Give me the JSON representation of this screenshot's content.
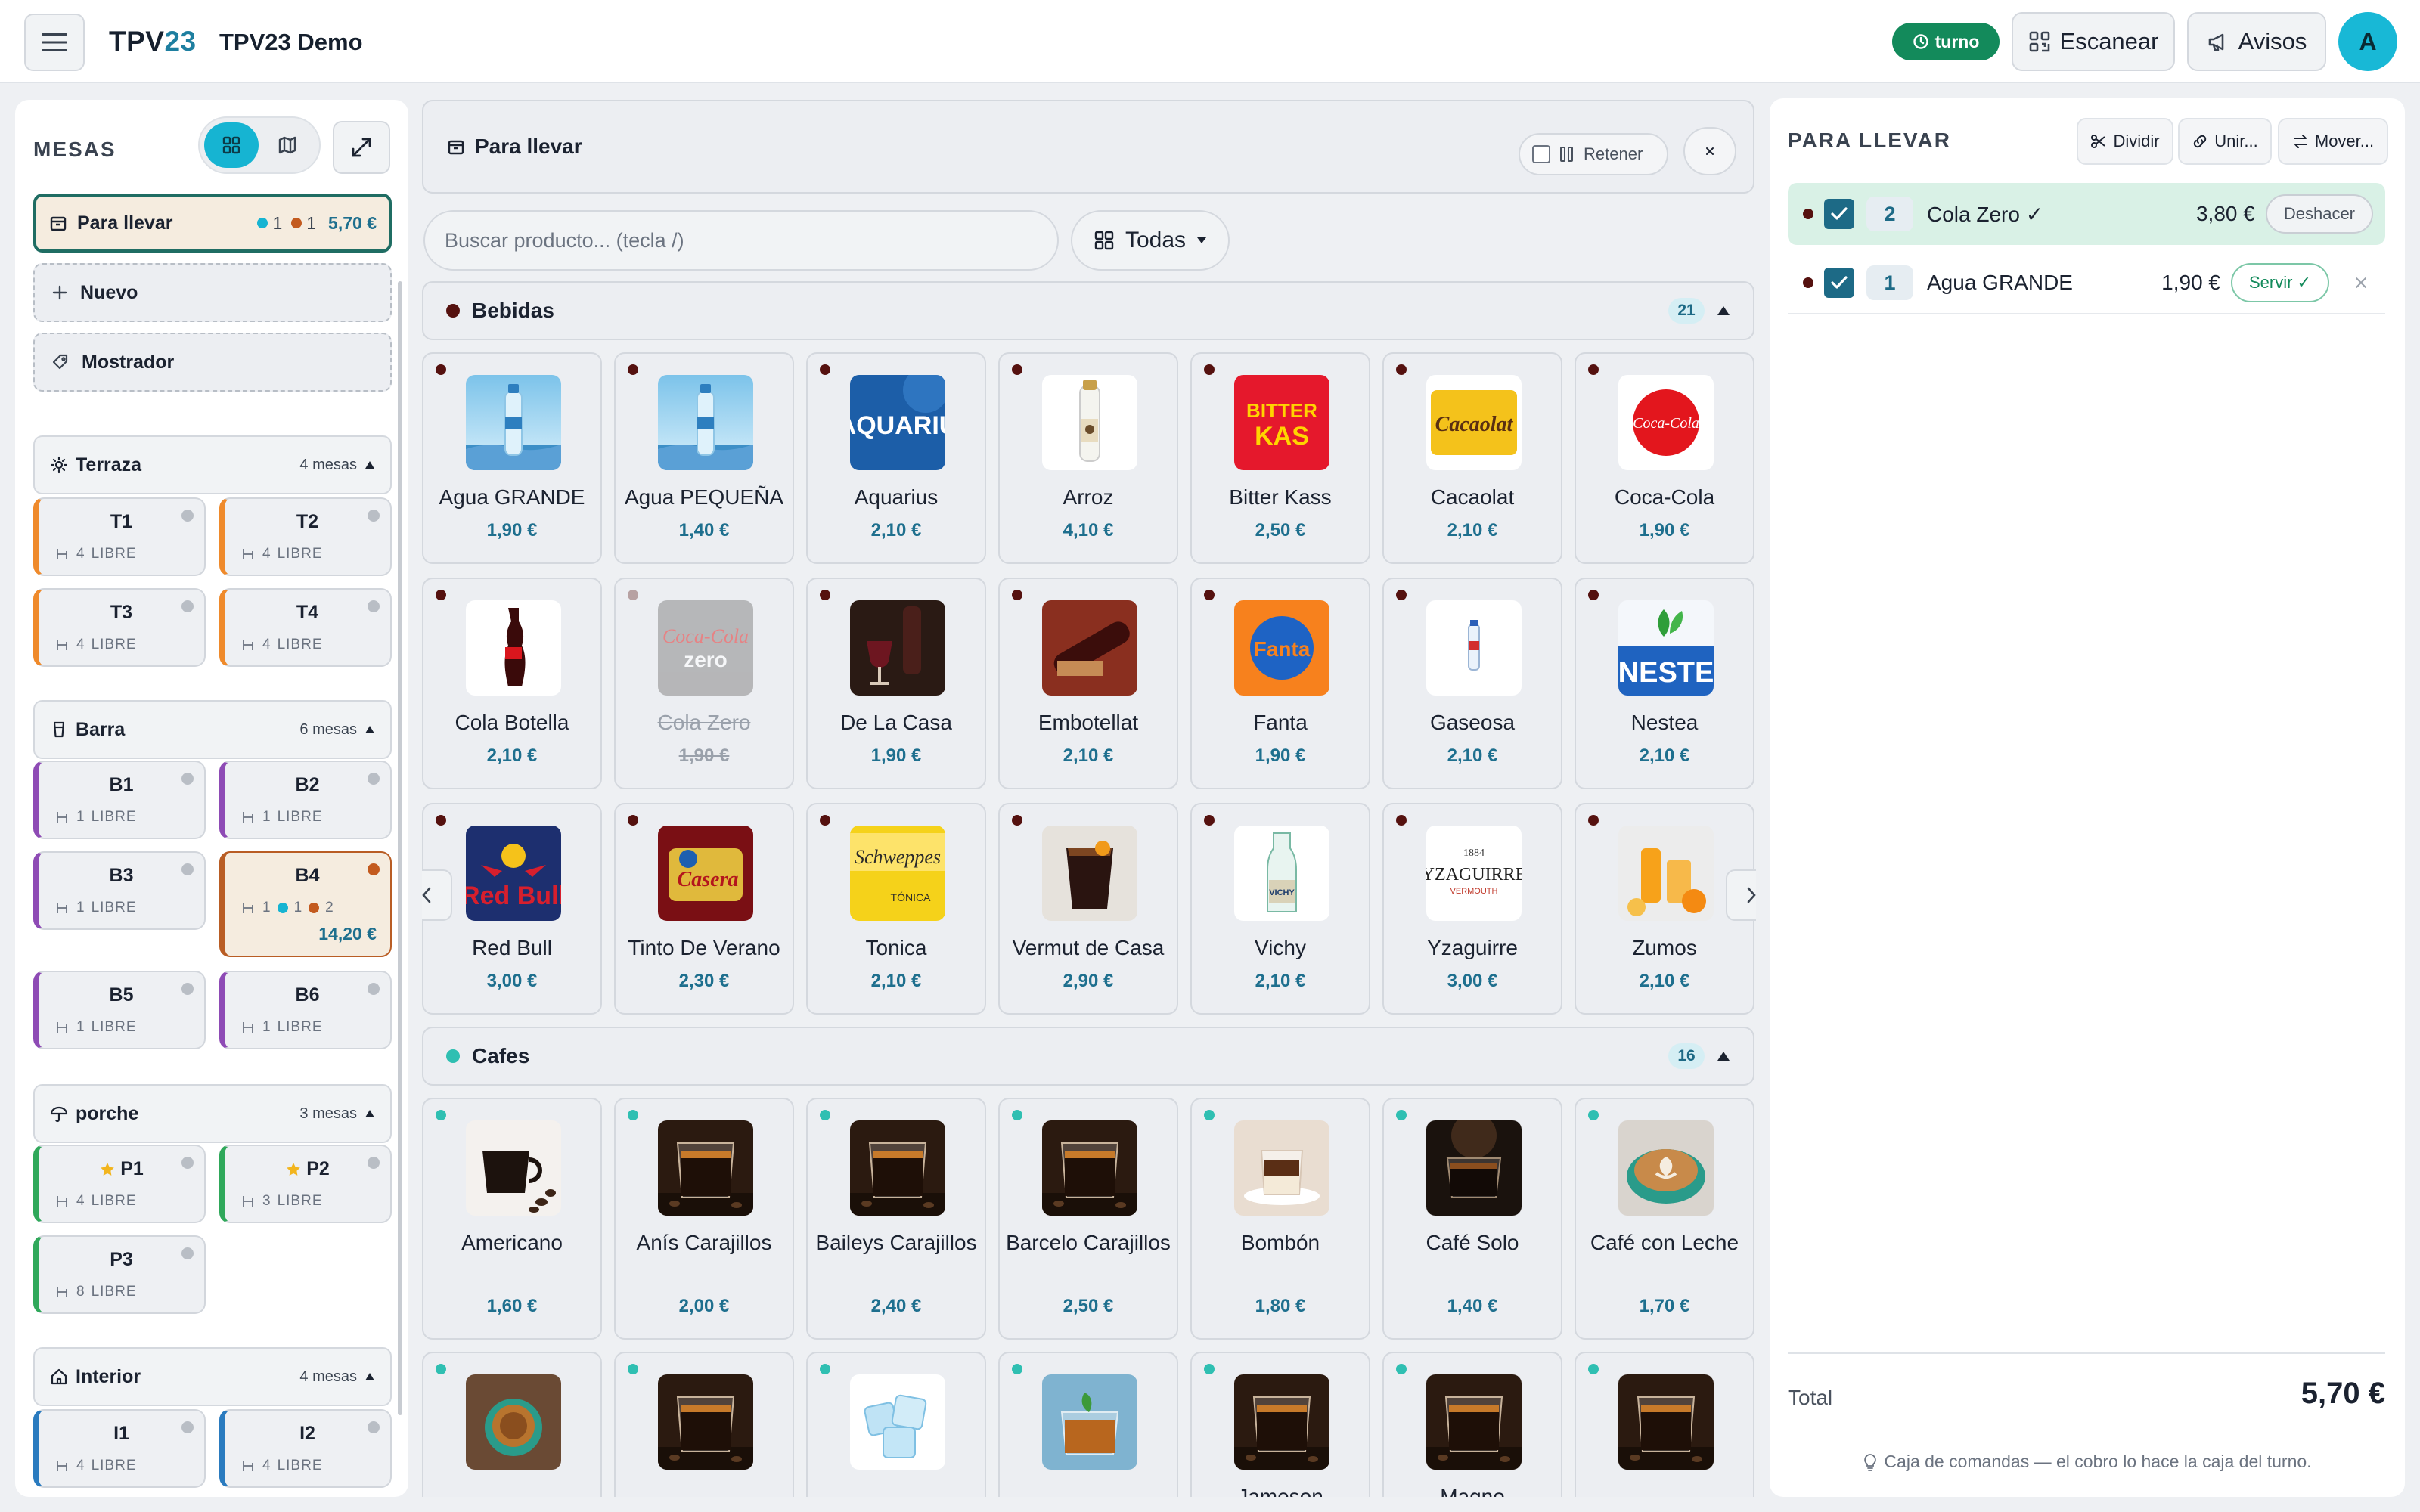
{
  "header": {
    "brand_prefix": "TPV",
    "brand_number": "23",
    "app_title": "TPV23 Demo",
    "turno_label": "turno",
    "scan_label": "Escanear",
    "avisos_label": "Avisos",
    "avatar_initial": "A"
  },
  "sidebar": {
    "title": "MESAS",
    "para_llevar": {
      "label": "Para llevar",
      "count_a": "1",
      "count_b": "1",
      "amount": "5,70 €"
    },
    "nuevo_label": "Nuevo",
    "mostrador_label": "Mostrador",
    "zones": [
      {
        "name": "Terraza",
        "count": "4 mesas",
        "tables": [
          {
            "name": "T1",
            "seats": "4",
            "status": "LIBRE"
          },
          {
            "name": "T2",
            "seats": "4",
            "status": "LIBRE"
          },
          {
            "name": "T3",
            "seats": "4",
            "status": "LIBRE"
          },
          {
            "name": "T4",
            "seats": "4",
            "status": "LIBRE"
          }
        ]
      },
      {
        "name": "Barra",
        "count": "6 mesas",
        "tables": [
          {
            "name": "B1",
            "seats": "1",
            "status": "LIBRE"
          },
          {
            "name": "B2",
            "seats": "1",
            "status": "LIBRE"
          },
          {
            "name": "B3",
            "seats": "1",
            "status": "LIBRE"
          },
          {
            "name": "B4",
            "seats": "1",
            "c1": "1",
            "c2": "2",
            "amount": "14,20 €"
          },
          {
            "name": "B5",
            "seats": "1",
            "status": "LIBRE"
          },
          {
            "name": "B6",
            "seats": "1",
            "status": "LIBRE"
          }
        ]
      },
      {
        "name": "porche",
        "count": "3 mesas",
        "tables": [
          {
            "name": "P1",
            "seats": "4",
            "status": "LIBRE"
          },
          {
            "name": "P2",
            "seats": "3",
            "status": "LIBRE"
          },
          {
            "name": "P3",
            "seats": "8",
            "status": "LIBRE"
          }
        ]
      },
      {
        "name": "Interior",
        "count": "4 mesas",
        "tables": [
          {
            "name": "I1",
            "seats": "4",
            "status": "LIBRE"
          },
          {
            "name": "I2",
            "seats": "4",
            "status": "LIBRE"
          }
        ]
      }
    ]
  },
  "main": {
    "title": "Para llevar",
    "retener_label": "Retener",
    "search_placeholder": "Buscar producto... (tecla /)",
    "category_label": "Todas",
    "sections": [
      {
        "name": "Bebidas",
        "count": "21",
        "dot_color": "#55110f",
        "products": [
          {
            "name": "Agua GRANDE",
            "price": "1,90 €",
            "img": "water"
          },
          {
            "name": "Agua PEQUEÑA",
            "price": "1,40 €",
            "img": "water"
          },
          {
            "name": "Aquarius",
            "price": "2,10 €",
            "img": "aquarius",
            "img_text": "AQUARIU"
          },
          {
            "name": "Arroz",
            "price": "4,10 €",
            "img": "bottle-white"
          },
          {
            "name": "Bitter Kass",
            "price": "2,50 €",
            "img": "bitter",
            "img_text": "BITTER KAS"
          },
          {
            "name": "Cacaolat",
            "price": "2,10 €",
            "img": "cacaolat",
            "img_text": "Cacaolat"
          },
          {
            "name": "Coca-Cola",
            "price": "1,90 €",
            "img": "cocacola",
            "img_text": "Coca-Cola"
          },
          {
            "name": "Cola Botella",
            "price": "2,10 €",
            "img": "cola-bottle"
          },
          {
            "name": "Cola Zero",
            "price": "1,90 €",
            "img": "colazero",
            "img_text": "zero",
            "off": true
          },
          {
            "name": "De La Casa",
            "price": "1,90 €",
            "img": "wine"
          },
          {
            "name": "Embotellat",
            "price": "2,10 €",
            "img": "wine-red"
          },
          {
            "name": "Fanta",
            "price": "1,90 €",
            "img": "fanta",
            "img_text": "Fanta"
          },
          {
            "name": "Gaseosa",
            "price": "2,10 €",
            "img": "gaseosa"
          },
          {
            "name": "Nestea",
            "price": "2,10 €",
            "img": "nestea",
            "img_text": "NESTE"
          },
          {
            "name": "Red Bull",
            "price": "3,00 €",
            "img": "redbull",
            "img_text": "Red Bull"
          },
          {
            "name": "Tinto De Verano",
            "price": "2,30 €",
            "img": "casera",
            "img_text": "Casera"
          },
          {
            "name": "Tonica",
            "price": "2,10 €",
            "img": "schweppes",
            "img_text": "Schweppes"
          },
          {
            "name": "Vermut de Casa",
            "price": "2,90 €",
            "img": "vermut"
          },
          {
            "name": "Vichy",
            "price": "2,10 €",
            "img": "vichy"
          },
          {
            "name": "Yzaguirre",
            "price": "3,00 €",
            "img": "yzaguirre",
            "img_text": "YZAGUIRRE"
          },
          {
            "name": "Zumos",
            "price": "2,10 €",
            "img": "zumos"
          }
        ]
      },
      {
        "name": "Cafes",
        "count": "16",
        "dot_color": "#2fbfb2",
        "products": [
          {
            "name": "Americano",
            "price": "1,60 €",
            "img": "coffee-beans"
          },
          {
            "name": "Anís Carajillos",
            "price": "2,00 €",
            "img": "espresso"
          },
          {
            "name": "Baileys Carajillos",
            "price": "2,40 €",
            "img": "espresso"
          },
          {
            "name": "Barcelo Carajillos",
            "price": "2,50 €",
            "img": "espresso"
          },
          {
            "name": "Bombón",
            "price": "1,80 €",
            "img": "bombon"
          },
          {
            "name": "Café Solo",
            "price": "1,40 €",
            "img": "cafe-solo"
          },
          {
            "name": "Café con Leche",
            "price": "1,70 €",
            "img": "latte"
          },
          {
            "name": "",
            "price": "",
            "img": "coffee-top"
          },
          {
            "name": "",
            "price": "",
            "img": "espresso"
          },
          {
            "name": "",
            "price": "",
            "img": "ice"
          },
          {
            "name": "",
            "price": "",
            "img": "tea"
          },
          {
            "name": "Jameson",
            "price": "",
            "img": "espresso"
          },
          {
            "name": "Magno",
            "price": "",
            "img": "espresso"
          },
          {
            "name": "",
            "price": "",
            "img": "espresso"
          }
        ]
      }
    ]
  },
  "order": {
    "title": "PARA LLEVAR",
    "dividir_label": "Dividir",
    "unir_label": "Unir...",
    "mover_label": "Mover...",
    "lines": [
      {
        "qty": "2",
        "name": "Cola Zero ✓",
        "price": "3,80 €",
        "action": "Deshacer"
      },
      {
        "qty": "1",
        "name": "Agua GRANDE",
        "price": "1,90 €",
        "action": "Servir ✓"
      }
    ],
    "total_label": "Total",
    "total_value": "5,70 €",
    "footnote": "Caja de comandas — el cobro lo hace la caja del turno."
  },
  "colors": {
    "accent": "#16b4d2",
    "price": "#1e6f8e",
    "turno": "#138a5b",
    "zone_terraza": "#ef8a2b",
    "zone_barra": "#8e4bb5",
    "zone_porche": "#2fa85a",
    "zone_interior": "#2a7bbf"
  },
  "icons": {
    "menu": "hamburger-icon",
    "scan": "qr-scan-icon",
    "avisos": "megaphone-icon",
    "grid": "grid-icon",
    "map": "map-icon",
    "expand": "expand-icon",
    "bag": "bag-icon",
    "plus": "plus-icon",
    "mostrador": "tag-icon",
    "sun": "sun-icon",
    "bar": "glass-icon",
    "umbrella": "umbrella-icon",
    "home": "home-icon",
    "seat": "chair-icon",
    "close": "close-icon",
    "chevron": "chevron-icon",
    "check": "check-icon",
    "scissors": "scissors-icon",
    "link": "link-icon",
    "swap": "swap-icon",
    "bulb": "lightbulb-icon",
    "star": "star-icon"
  }
}
